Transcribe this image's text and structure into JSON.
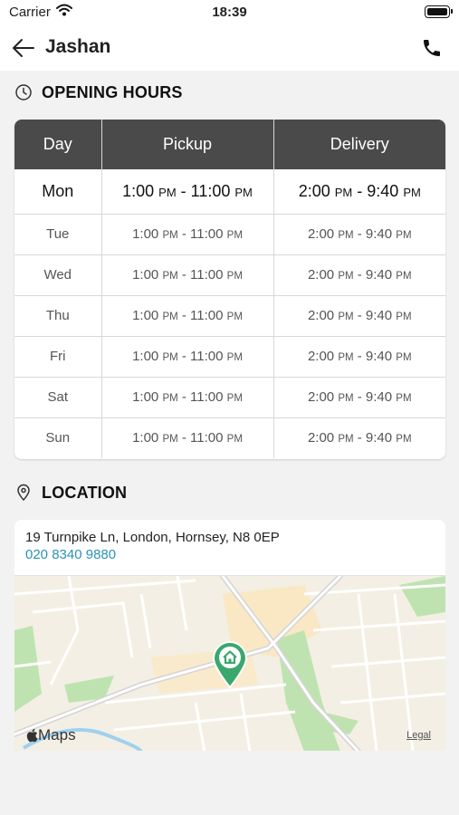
{
  "status_bar": {
    "carrier": "Carrier",
    "time": "18:39"
  },
  "nav": {
    "title": "Jashan"
  },
  "opening_hours": {
    "title": "OPENING HOURS",
    "headers": {
      "day": "Day",
      "pickup": "Pickup",
      "delivery": "Delivery"
    },
    "rows": [
      {
        "day": "Mon",
        "pickup_open": "1:00",
        "pickup_open_ampm": "PM",
        "pickup_close": "11:00",
        "pickup_close_ampm": "PM",
        "delivery_open": "2:00",
        "delivery_open_ampm": "PM",
        "delivery_close": "9:40",
        "delivery_close_ampm": "PM"
      },
      {
        "day": "Tue",
        "pickup_open": "1:00",
        "pickup_open_ampm": "PM",
        "pickup_close": "11:00",
        "pickup_close_ampm": "PM",
        "delivery_open": "2:00",
        "delivery_open_ampm": "PM",
        "delivery_close": "9:40",
        "delivery_close_ampm": "PM"
      },
      {
        "day": "Wed",
        "pickup_open": "1:00",
        "pickup_open_ampm": "PM",
        "pickup_close": "11:00",
        "pickup_close_ampm": "PM",
        "delivery_open": "2:00",
        "delivery_open_ampm": "PM",
        "delivery_close": "9:40",
        "delivery_close_ampm": "PM"
      },
      {
        "day": "Thu",
        "pickup_open": "1:00",
        "pickup_open_ampm": "PM",
        "pickup_close": "11:00",
        "pickup_close_ampm": "PM",
        "delivery_open": "2:00",
        "delivery_open_ampm": "PM",
        "delivery_close": "9:40",
        "delivery_close_ampm": "PM"
      },
      {
        "day": "Fri",
        "pickup_open": "1:00",
        "pickup_open_ampm": "PM",
        "pickup_close": "11:00",
        "pickup_close_ampm": "PM",
        "delivery_open": "2:00",
        "delivery_open_ampm": "PM",
        "delivery_close": "9:40",
        "delivery_close_ampm": "PM"
      },
      {
        "day": "Sat",
        "pickup_open": "1:00",
        "pickup_open_ampm": "PM",
        "pickup_close": "11:00",
        "pickup_close_ampm": "PM",
        "delivery_open": "2:00",
        "delivery_open_ampm": "PM",
        "delivery_close": "9:40",
        "delivery_close_ampm": "PM"
      },
      {
        "day": "Sun",
        "pickup_open": "1:00",
        "pickup_open_ampm": "PM",
        "pickup_close": "11:00",
        "pickup_close_ampm": "PM",
        "delivery_open": "2:00",
        "delivery_open_ampm": "PM",
        "delivery_close": "9:40",
        "delivery_close_ampm": "PM"
      }
    ]
  },
  "location": {
    "title": "LOCATION",
    "address": "19 Turnpike Ln, London, Hornsey, N8 0EP",
    "phone": "020 8340 9880",
    "map_brand": "Maps",
    "map_legal": "Legal"
  },
  "icons": {
    "back": "arrow-left-icon",
    "call": "phone-icon",
    "hours": "clock-icon",
    "location": "location-pin-icon",
    "map_marker": "home-marker-icon"
  },
  "colors": {
    "table_header": "#4a4a4a",
    "link": "#2a93b4",
    "map_pin": "#3aa76d",
    "background": "#f2f2f2"
  }
}
